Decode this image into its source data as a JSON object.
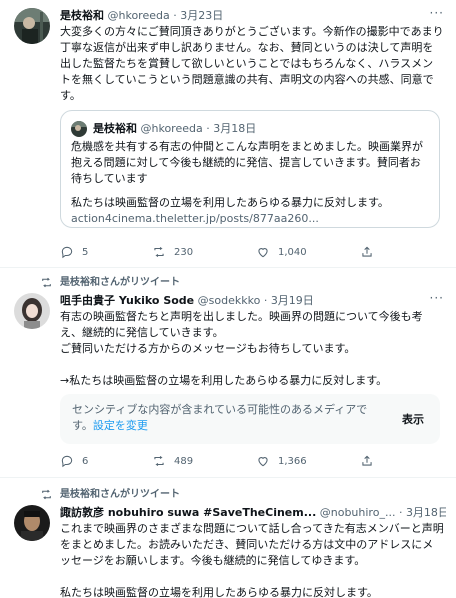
{
  "tweet1": {
    "author_name": "是枝裕和",
    "author_handle": "@hkoreeda",
    "separator": "·",
    "date": "3月23日",
    "more": "···",
    "body": "大変多くの方々にご賛同頂きありがとうございます。今新作の撮影中であまり丁寧な返信が出来ず申し訳ありません。なお、賛同というのは決して声明を出した監督たちを賞賛して欲しいということではもちろんなく、ハラスメントを無くしていこうという問題意識の共有、声明文の内容への共感、同意です。",
    "quote": {
      "author_name": "是枝裕和",
      "author_handle": "@hkoreeda",
      "separator": "·",
      "date": "3月18日",
      "body": "危機感を共有する有志の仲間とこんな声明をまとめました。映画業界が抱える問題に対して今後も継続的に発信、提言していきます。賛同者お待ちしています",
      "body2": "私たちは映画監督の立場を利用したあらゆる暴力に反対します。",
      "link": "action4cinema.theletter.jp/posts/877aa260..."
    },
    "replies": "5",
    "retweets": "230",
    "likes": "1,040"
  },
  "tweet2": {
    "retweet_label": "是枝裕和さんがリツイート",
    "author_name": "咀手由貴子 Yukiko Sode",
    "author_handle": "@sodekkko",
    "separator": "·",
    "date": "3月19日",
    "more": "···",
    "body": "有志の映画監督たちと声明を出しました。映画界の問題について今後も考え、継続的に発信していきます。\nご賛同いただける方からのメッセージもお待ちしています。\n\n→私たちは映画監督の立場を利用したあらゆる暴力に反対します。",
    "sensitive_text": "センシティブな内容が含まれている可能性のあるメディアです。",
    "sensitive_link": "設定を変更",
    "show_label": "表示",
    "replies": "6",
    "retweets": "489",
    "likes": "1,366"
  },
  "tweet3": {
    "retweet_label": "是枝裕和さんがリツイート",
    "author_name": "諏訪敦彦 nobuhiro suwa #SaveTheCinem...",
    "author_handle": "@nobuhiro_...",
    "separator": "·",
    "date": "3月18日",
    "body": "これまで映画界のさまざまな問題について話し合ってきた有志メンバーと声明をまとめました。お読みいただき、賛同いただける方は文中のアドレスにメッセージをお願いします。今後も継続的に発信してゆきます。\n\n私たちは映画監督の立場を利用したあらゆる暴力に反対します。"
  },
  "colors": {
    "text": "#0f1419",
    "muted": "#536471",
    "link": "#1d9bf0",
    "border": "#eff3f4"
  },
  "icons": [
    "reply-icon",
    "retweet-icon",
    "like-icon",
    "share-icon",
    "more-icon"
  ]
}
